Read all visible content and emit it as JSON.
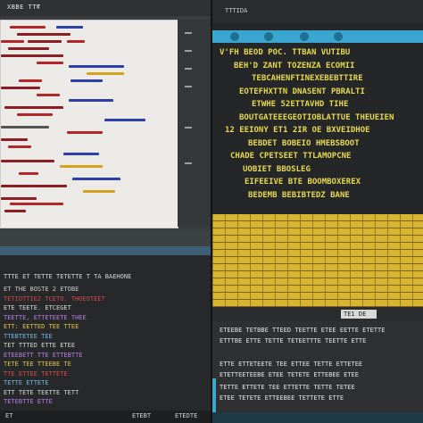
{
  "left_editor": {
    "title": "XBBE TTT",
    "close_glyph": "×",
    "code_colors": [
      "#b3262a",
      "#2d3fa8",
      "#d4a21b",
      "#555555",
      "#8a1f23"
    ]
  },
  "right_editor": {
    "title": "TTTIDA",
    "lines": [
      {
        "text": "V'FH BEOD POC. TTBAN VUTIBU",
        "color": "#e8d84a"
      },
      {
        "text": "BEH'D ZANT TOZENZA ECOMII",
        "color": "#e8d84a"
      },
      {
        "text": "TEBCAHENFTINEXEBEBTTIRE",
        "color": "#e8d84a"
      },
      {
        "text": "EOTEFHXTTN DNASENT PBRALTI",
        "color": "#e8d84a"
      },
      {
        "text": "ETWHE 52ETTAVHD TIHE",
        "color": "#e8d84a"
      },
      {
        "text": "BOUTGATEEEGEOTIOBLATTUE THEUEIEN",
        "color": "#e8d84a"
      },
      {
        "text": "12 EEIONY ET1 2IR OE BXVEIDHOE",
        "color": "#e8d84a"
      },
      {
        "text": "BEBDET BOBEIO HMEBSBOOT",
        "color": "#e8d84a"
      },
      {
        "text": "CHADE CPETSEET TTLAMOPCNE",
        "color": "#e8d84a"
      },
      {
        "text": "UOBIET BBOSLEG",
        "color": "#e8d84a"
      },
      {
        "text": "EIFEEIVE BTE BOOMBOXEREX",
        "color": "#e8d84a"
      },
      {
        "text": "BEDEMB BEBIBTEDZ BANE",
        "color": "#e8d84a"
      }
    ],
    "accent": "#3aa6cf",
    "brick": "#d8b431"
  },
  "terminal": {
    "rows": [
      {
        "text": "ET THE BOSTE 2 ETOBE",
        "color": "#c8c8c8"
      },
      {
        "text": "TETIOTTIE2 TCETO. THOEOTEET",
        "color": "#cf4a4a"
      },
      {
        "text": "ETE TEETE. ETCEGET",
        "color": "#d6d6d6"
      },
      {
        "text": "TEETTE, ETTETEETE THEE",
        "color": "#b37ee0"
      },
      {
        "text": "ETT: EETTED TEE TTEE",
        "color": "#e0c04a"
      },
      {
        "text": "TTEBTETEE TEE",
        "color": "#6fb8e0"
      },
      {
        "text": "TET TTTED ETTE ETEE",
        "color": "#d6d6d6"
      },
      {
        "text": "ETEEBETT TTE ETTEBTTE",
        "color": "#b37ee0"
      },
      {
        "text": "TETE TEE TTEEBE TE",
        "color": "#e0c04a"
      },
      {
        "text": "TTE ETTEE TETTETE",
        "color": "#cf4a4a"
      },
      {
        "text": "TETTE ETTETE",
        "color": "#6fb8e0"
      },
      {
        "text": "ETT TETE TEETTE TETT",
        "color": "#d6d6d6"
      },
      {
        "text": "TETEBTTE ETTE",
        "color": "#b37ee0"
      }
    ],
    "header": "TTTE  ET TETTE  TETETTE   T  TA BAEHONE",
    "footer_left": "ET",
    "footer_mid": "ETEBT",
    "footer_right": "ETEDTE"
  },
  "log": {
    "field_value": "TE1  DE",
    "rows": [
      "ETEEBE TETBBE TTEED TEETTE ETEE EETTE ETETTE",
      "ETTTBE ETTE TETTE TETEETTTE TEETTE ETTE",
      "ETTE ETTETEETE TEE ETTEE TETTE ETTETEE",
      "ETETTEETEEBE ETEE TETETE ETTEBEE ETEE",
      "TETTE ETTETE TEE ETTETTE TETTE TETEE",
      "ETEE TETETE ETTEEBEE TETTETE ETTE"
    ]
  }
}
